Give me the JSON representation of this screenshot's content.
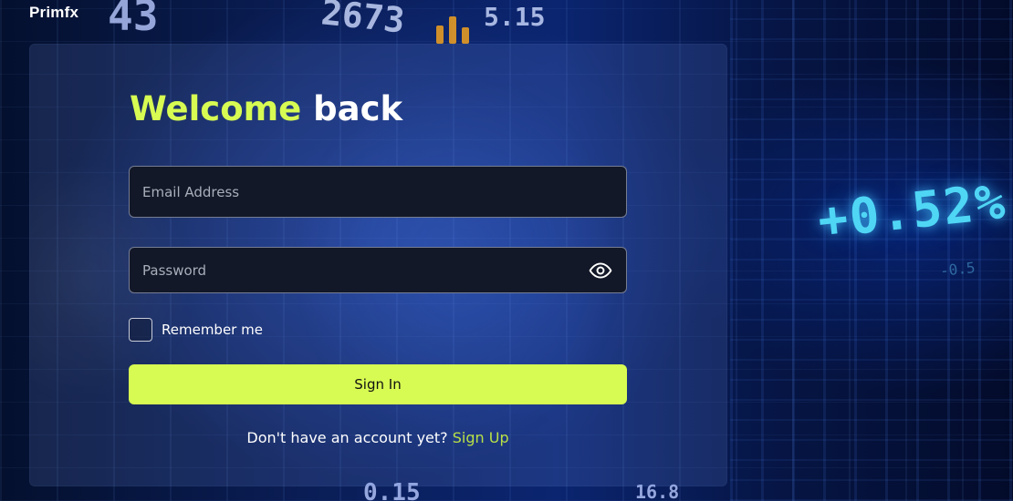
{
  "brand": {
    "name": "Primfx"
  },
  "background": {
    "ticker_big": "+0.52%",
    "ticker_small": "-0.5",
    "numbers": [
      "43",
      "2673",
      "5.15",
      "0.15",
      "16.8"
    ]
  },
  "login": {
    "title_accent": "Welcome",
    "title_rest": "back",
    "email_placeholder": "Email Address",
    "email_value": "",
    "password_placeholder": "Password",
    "password_value": "",
    "remember_label": "Remember me",
    "remember_checked": false,
    "signin_label": "Sign In",
    "no_account_text": "Don't have an account yet?",
    "signup_label": "Sign Up"
  },
  "colors": {
    "accent": "#d7fb52",
    "link": "#b8e046",
    "field_bg": "#121827",
    "ticker": "#4fd6f5"
  },
  "icons": {
    "password_toggle": "eye-icon"
  }
}
